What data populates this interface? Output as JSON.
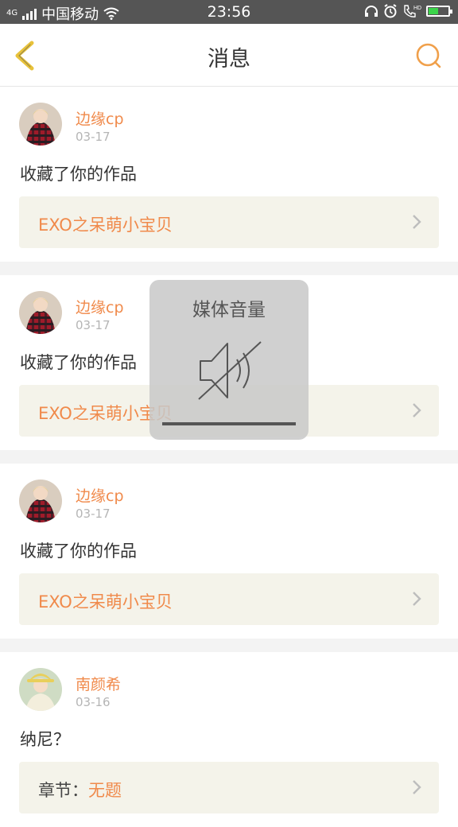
{
  "status_bar": {
    "carrier": "中国移动",
    "network": "4G",
    "time": "23:56",
    "battery_level": 0.55
  },
  "header": {
    "title": "消息",
    "back_icon": "chevron-left-icon",
    "search_icon": "search-icon",
    "accent_color": "#f0a04b"
  },
  "messages": [
    {
      "username": "边缘cp",
      "date": "03-17",
      "action": "收藏了你的作品",
      "ref_prefix": "",
      "ref_title": "EXO之呆萌小宝贝"
    },
    {
      "username": "边缘cp",
      "date": "03-17",
      "action": "收藏了你的作品",
      "ref_prefix": "",
      "ref_title": "EXO之呆萌小宝贝"
    },
    {
      "username": "边缘cp",
      "date": "03-17",
      "action": "收藏了你的作品",
      "ref_prefix": "",
      "ref_title": "EXO之呆萌小宝贝"
    },
    {
      "username": "南颜希",
      "date": "03-16",
      "action": "纳尼？",
      "ref_prefix": "章节：",
      "ref_title": "无题"
    }
  ],
  "volume_overlay": {
    "title": "媒体音量",
    "icon": "speaker-muted-icon",
    "level": 0
  },
  "colors": {
    "username": "#f08a4b",
    "ref_background": "#f4f3ea",
    "status_bar": "#555555"
  }
}
